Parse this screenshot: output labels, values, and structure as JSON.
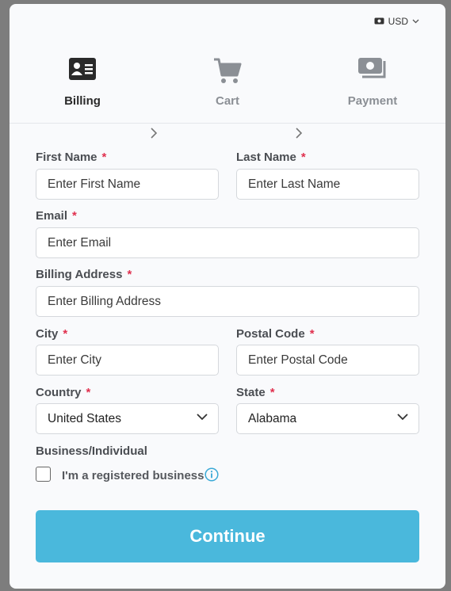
{
  "currency": {
    "label": "USD"
  },
  "steps": [
    {
      "label": "Billing",
      "icon": "id-card-icon",
      "state": "active"
    },
    {
      "label": "Cart",
      "icon": "cart-icon",
      "state": "inactive"
    },
    {
      "label": "Payment",
      "icon": "payment-icon",
      "state": "inactive"
    }
  ],
  "form": {
    "first_name": {
      "label": "First Name",
      "required": "*",
      "placeholder": "Enter First Name"
    },
    "last_name": {
      "label": "Last Name",
      "required": "*",
      "placeholder": "Enter Last Name"
    },
    "email": {
      "label": "Email",
      "required": "*",
      "placeholder": "Enter Email"
    },
    "billing_address": {
      "label": "Billing Address",
      "required": "*",
      "placeholder": "Enter Billing Address"
    },
    "city": {
      "label": "City",
      "required": "*",
      "placeholder": "Enter City"
    },
    "postal_code": {
      "label": "Postal Code",
      "required": "*",
      "placeholder": "Enter Postal Code"
    },
    "country": {
      "label": "Country",
      "required": "*",
      "value": "United States"
    },
    "state": {
      "label": "State",
      "required": "*",
      "value": "Alabama"
    },
    "business": {
      "label": "Business/Individual",
      "checkbox_label": "I'm a registered business",
      "checked": false
    }
  },
  "continue_label": "Continue",
  "colors": {
    "accent": "#4ab8dc",
    "required": "#e0304e",
    "active_step": "#2a2a2a",
    "inactive_step": "#8b8f95"
  }
}
